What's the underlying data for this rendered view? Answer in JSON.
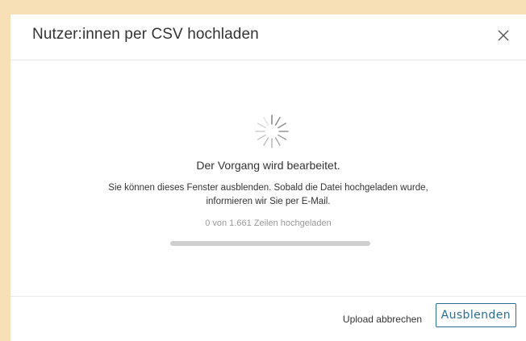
{
  "dialog": {
    "title": "Nutzer:innen per CSV hochladen",
    "close_icon": "close-icon"
  },
  "status": {
    "spinner_icon": "loading-spinner-icon",
    "title": "Der Vorgang wird bearbeitet.",
    "message_line1": "Sie können dieses Fenster ausblenden. Sobald die Datei hochgeladen wurde,",
    "message_line2": "informieren wir Sie per E-Mail.",
    "progress_text": "0 von 1.661 Zeilen hochgeladen",
    "progress_fraction": 0,
    "progress_color": "#6f2c91"
  },
  "footer": {
    "cancel_label": "Upload abbrechen",
    "hide_label": "Ausblenden",
    "accent": "#2c6e91"
  }
}
